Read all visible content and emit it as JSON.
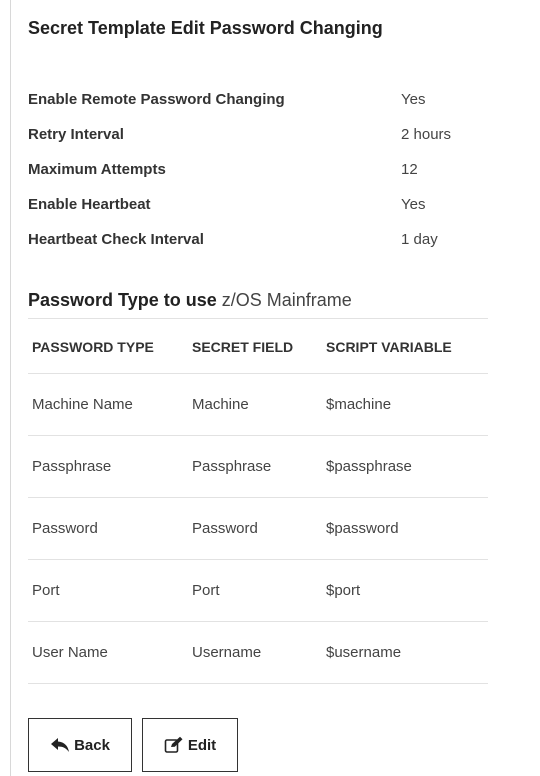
{
  "title": "Secret Template Edit Password Changing",
  "properties": [
    {
      "label": "Enable Remote Password Changing",
      "value": "Yes"
    },
    {
      "label": "Retry Interval",
      "value": "2 hours"
    },
    {
      "label": "Maximum Attempts",
      "value": "12"
    },
    {
      "label": "Enable Heartbeat",
      "value": "Yes"
    },
    {
      "label": "Heartbeat Check Interval",
      "value": "1 day"
    }
  ],
  "password_type": {
    "heading_prefix": "Password Type to use",
    "value": "z/OS Mainframe"
  },
  "table": {
    "headers": [
      "PASSWORD TYPE",
      "SECRET FIELD",
      "SCRIPT VARIABLE"
    ],
    "rows": [
      [
        "Machine Name",
        "Machine",
        "$machine"
      ],
      [
        "Passphrase",
        "Passphrase",
        "$passphrase"
      ],
      [
        "Password",
        "Password",
        "$password"
      ],
      [
        "Port",
        "Port",
        "$port"
      ],
      [
        "User Name",
        "Username",
        "$username"
      ]
    ]
  },
  "buttons": {
    "back_label": "Back",
    "back_icon": "reply-arrow-icon",
    "edit_label": "Edit",
    "edit_icon": "edit-icon"
  }
}
